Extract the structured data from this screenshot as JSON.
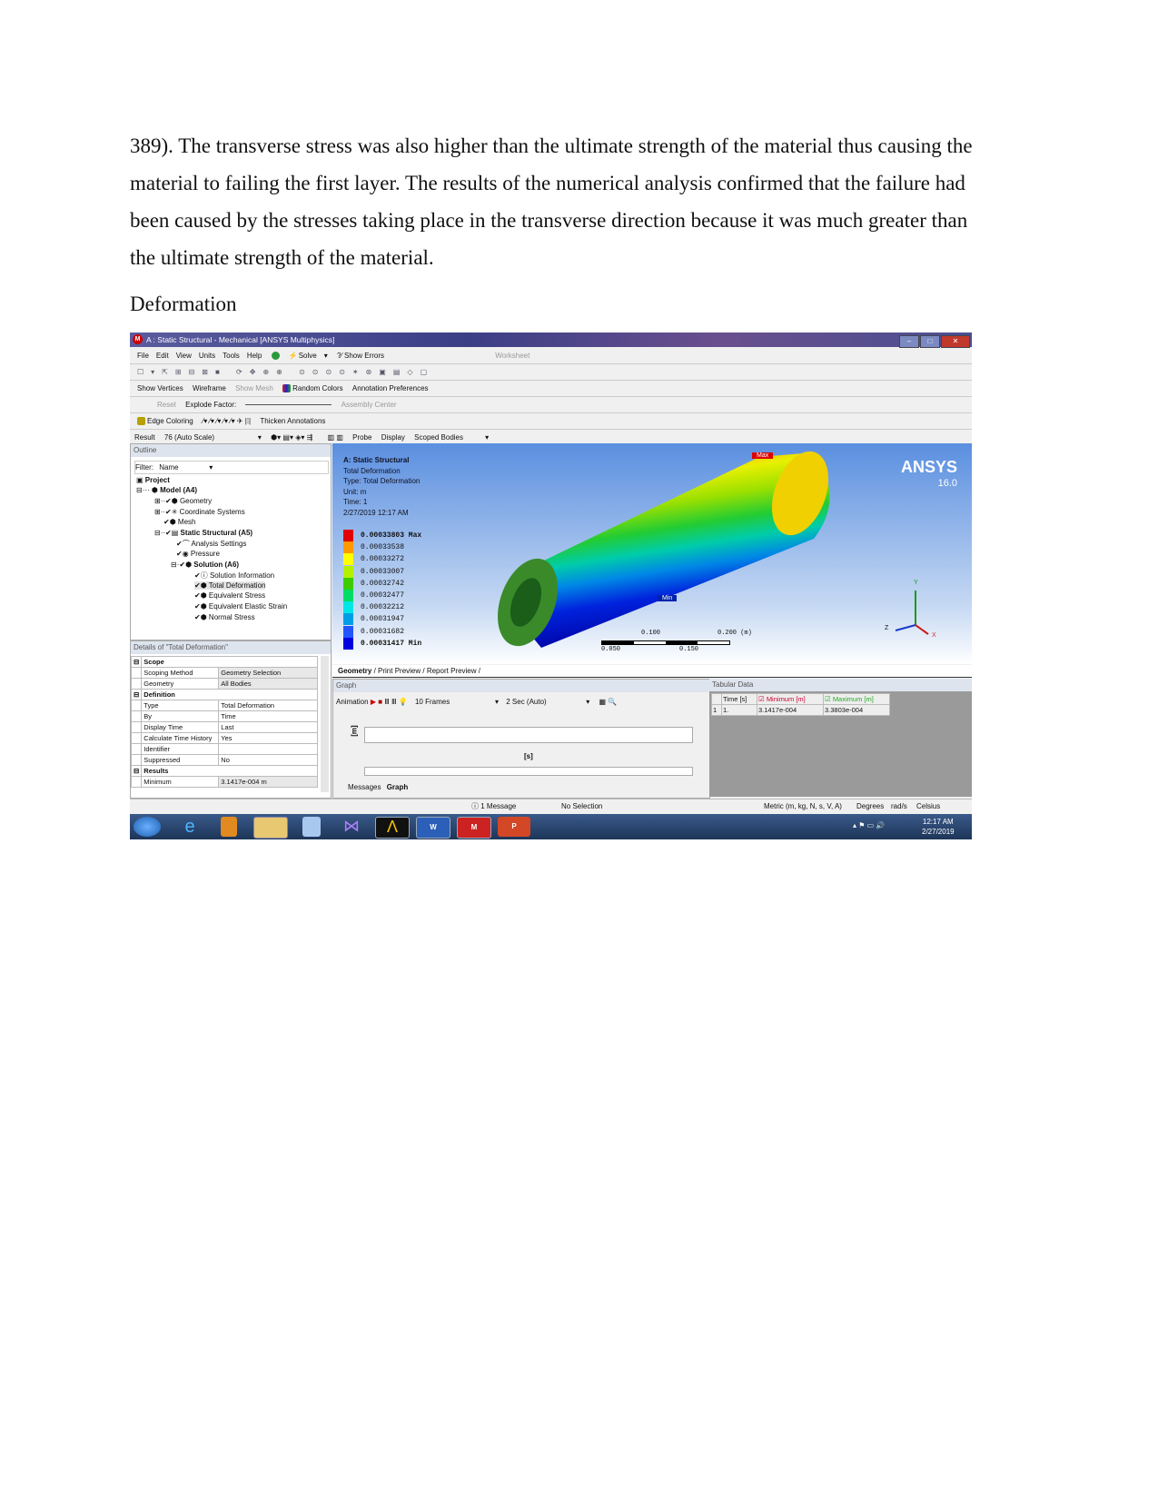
{
  "document": {
    "paragraph": "389). The transverse stress was also higher than the ultimate strength of the material thus causing the material to failing the first layer. The results of the numerical analysis confirmed that the failure had been caused by the stresses taking place in the transverse direction because it was much greater than the ultimate strength of the material.",
    "heading": "Deformation"
  },
  "app": {
    "title": "A : Static Structural - Mechanical [ANSYS Multiphysics]",
    "menu": [
      "File",
      "Edit",
      "View",
      "Units",
      "Tools",
      "Help"
    ],
    "toolbar1": {
      "solve": "Solve",
      "show_errors": "?⁄ Show Errors",
      "worksheet": "Worksheet"
    },
    "toolbar3": {
      "show_vertices": "Show Vertices",
      "wireframe": "Wireframe",
      "show_mesh": "Show Mesh",
      "random_colors": "Random Colors",
      "annotation_prefs": "Annotation Preferences"
    },
    "toolbar4": {
      "reset": "Reset",
      "explode_factor": "Explode Factor:",
      "assembly_center": "Assembly Center"
    },
    "toolbar5": {
      "edge_coloring": "Edge Coloring",
      "thicken": "Thicken Annotations"
    },
    "toolbar6": {
      "result_label": "Result",
      "result_value": "76 (Auto Scale)",
      "probe": "Probe",
      "display": "Display",
      "scoped": "Scoped Bodies"
    },
    "outline": {
      "title": "Outline",
      "filter_label": "Filter:",
      "filter_value": "Name",
      "tree": [
        "Project",
        "Model (A4)",
        "Geometry",
        "Coordinate Systems",
        "Mesh",
        "Static Structural (A5)",
        "Analysis Settings",
        "Pressure",
        "Solution (A6)",
        "Solution Information",
        "Total Deformation",
        "Equivalent Stress",
        "Equivalent Elastic Strain",
        "Normal Stress"
      ]
    },
    "viewport": {
      "header": [
        "A: Static Structural",
        "Total Deformation",
        "Type: Total Deformation",
        "Unit: m",
        "Time: 1",
        "2/27/2019 12:17 AM"
      ],
      "legend": [
        "0.00033803 Max",
        "0.00033538",
        "0.00033272",
        "0.00033007",
        "0.00032742",
        "0.00032477",
        "0.00032212",
        "0.00031947",
        "0.00031682",
        "0.00031417 Min"
      ],
      "legend_colors": [
        "#e00000",
        "#ff9900",
        "#ffff00",
        "#b4f000",
        "#3ccc00",
        "#00dd66",
        "#00e6e6",
        "#009ee6",
        "#2255ff",
        "#0000e0"
      ],
      "max_tag": "Max",
      "min_tag": "Min",
      "brand": "ANSYS",
      "version": "16.0",
      "scale": {
        "top": [
          "0.100",
          "0.200 (m)"
        ],
        "bottom": [
          "0.050",
          "0.150"
        ]
      },
      "axes": {
        "y": "Y",
        "z": "Z",
        "x": "X"
      }
    },
    "view_tabs": [
      "Geometry",
      "Print Preview",
      "Report Preview"
    ],
    "details": {
      "title": "Details of \"Total Deformation\"",
      "rows": [
        {
          "k": "Scope",
          "sec": true
        },
        {
          "k": "Scoping Method",
          "v": "Geometry Selection"
        },
        {
          "k": "Geometry",
          "v": "All Bodies"
        },
        {
          "k": "Definition",
          "sec": true
        },
        {
          "k": "Type",
          "v": "Total Deformation"
        },
        {
          "k": "By",
          "v": "Time"
        },
        {
          "k": "Display Time",
          "v": "Last"
        },
        {
          "k": "Calculate Time History",
          "v": "Yes"
        },
        {
          "k": "Identifier",
          "v": ""
        },
        {
          "k": "Suppressed",
          "v": "No"
        },
        {
          "k": "Results",
          "sec": true
        },
        {
          "k": "Minimum",
          "v": "3.1417e-004 m"
        }
      ]
    },
    "graph": {
      "title": "Graph",
      "animation": "Animation",
      "frames": "10 Frames",
      "duration": "2 Sec (Auto)",
      "ylabel": "[m]",
      "xlabel": "[s]",
      "tabs": [
        "Messages",
        "Graph"
      ]
    },
    "tabular": {
      "title": "Tabular Data",
      "headers": [
        "Time [s]",
        "Minimum [m]",
        "Maximum [m]"
      ],
      "row": [
        "1",
        "1.",
        "3.1417e-004",
        "3.3803e-004"
      ]
    },
    "status": {
      "messages": "1 Message",
      "selection": "No Selection",
      "units": "Metric (m, kg, N, s, V, A)",
      "angle": "Degrees",
      "rate": "rad/s",
      "temp": "Celsius"
    },
    "taskbar": {
      "time": "12:17 AM",
      "date": "2/27/2019"
    }
  }
}
